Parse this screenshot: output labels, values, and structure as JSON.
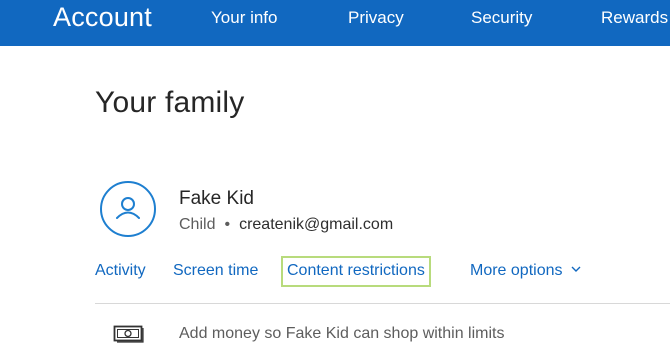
{
  "header": {
    "brand": "Account",
    "nav": {
      "your_info": "Your info",
      "privacy": "Privacy",
      "security": "Security",
      "rewards": "Rewards"
    },
    "background_color": "#1168c0"
  },
  "page": {
    "title": "Your family"
  },
  "member": {
    "name": "Fake Kid",
    "role": "Child",
    "separator": "•",
    "email": "createnik@gmail.com",
    "avatar_icon": "user-icon"
  },
  "tabs": {
    "activity": "Activity",
    "screen_time": "Screen time",
    "content_restrictions": "Content restrictions",
    "more_options": "More options"
  },
  "actions": {
    "add_money": "Add money so Fake Kid can shop within limits",
    "add_money_icon": "money-icon"
  },
  "colors": {
    "accent": "#1168c0",
    "highlight_border": "#b8db7c"
  }
}
